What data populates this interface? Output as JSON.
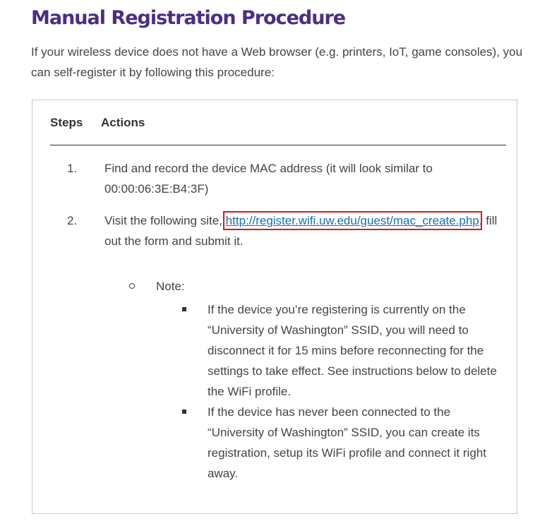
{
  "heading": "Manual Registration Procedure",
  "intro": "If your wireless device does not have a Web browser (e.g. printers, IoT, game consoles), you can self-register it by following this procedure:",
  "table": {
    "headers": {
      "steps": "Steps",
      "actions": "Actions"
    },
    "rows": [
      {
        "number": "1.",
        "text": "Find and record the device MAC address (it will look similar to 00:00:06:3E:B4:3F)"
      },
      {
        "number": "2.",
        "text_before": "Visit the following site, ",
        "link": "http://register.wifi.uw.edu/guest/mac_create.php",
        "text_after": ", fill out the form and submit it.",
        "note_label": "Note:",
        "bullets": [
          "If the device you’re registering is currently on the “University of Washington” SSID, you will need to disconnect it for 15 mins before reconnecting for the settings to take effect. See instructions below to delete the WiFi profile.",
          "If the device has never been connected to the “University of Washington” SSID, you can create its registration, setup its WiFi profile and connect it right away."
        ]
      }
    ]
  },
  "colors": {
    "heading": "#4b2e83",
    "link": "#1a6fb3",
    "highlight": "#d9181e"
  }
}
